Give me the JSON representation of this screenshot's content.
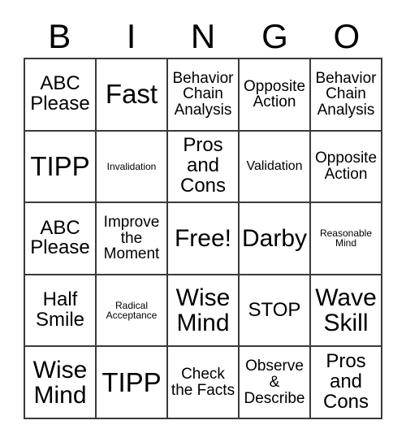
{
  "card": {
    "header_letters": [
      "B",
      "I",
      "N",
      "G",
      "O"
    ],
    "columns": 5,
    "rows": 5,
    "free_space_label": "Free!",
    "colors": {
      "background": "#ffffff",
      "grid_line": "#3a3a3a",
      "text": "#000000"
    },
    "cells": [
      [
        {
          "text": "ABC Please",
          "size": "md"
        },
        {
          "text": "Fast",
          "size": "xl"
        },
        {
          "text": "Behavior Chain Analysis",
          "size": "sm"
        },
        {
          "text": "Opposite Action",
          "size": "sm"
        },
        {
          "text": "Behavior Chain Analysis",
          "size": "sm"
        }
      ],
      [
        {
          "text": "TIPP",
          "size": "xl"
        },
        {
          "text": "Invalidation",
          "size": "xxs"
        },
        {
          "text": "Pros and Cons",
          "size": "md"
        },
        {
          "text": "Validation",
          "size": "xs"
        },
        {
          "text": "Opposite Action",
          "size": "sm"
        }
      ],
      [
        {
          "text": "ABC Please",
          "size": "md"
        },
        {
          "text": "Improve the Moment",
          "size": "sm"
        },
        {
          "text": "Free!",
          "size": "lg"
        },
        {
          "text": "Darby",
          "size": "lg"
        },
        {
          "text": "Reasonable Mind",
          "size": "xxs"
        }
      ],
      [
        {
          "text": "Half Smile",
          "size": "md"
        },
        {
          "text": "Radical Acceptance",
          "size": "xxs"
        },
        {
          "text": "Wise Mind",
          "size": "lg"
        },
        {
          "text": "STOP",
          "size": "md"
        },
        {
          "text": "Wave Skill",
          "size": "lg"
        }
      ],
      [
        {
          "text": "Wise Mind",
          "size": "lg"
        },
        {
          "text": "TIPP",
          "size": "xl"
        },
        {
          "text": "Check the Facts",
          "size": "sm"
        },
        {
          "text": "Observe & Describe",
          "size": "sm"
        },
        {
          "text": "Pros and Cons",
          "size": "md"
        }
      ]
    ]
  }
}
